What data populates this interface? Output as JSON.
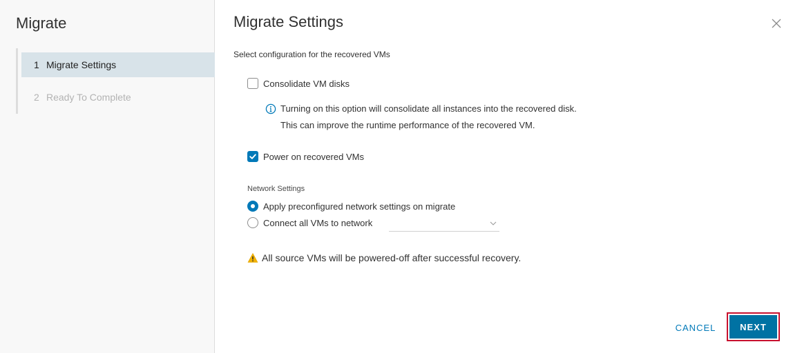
{
  "sidebar": {
    "title": "Migrate",
    "steps": [
      {
        "number": "1",
        "label": "Migrate Settings"
      },
      {
        "number": "2",
        "label": "Ready To Complete"
      }
    ]
  },
  "main": {
    "title": "Migrate Settings",
    "subtitle": "Select configuration for the recovered VMs",
    "consolidate": {
      "label": "Consolidate VM disks",
      "info_line1": "Turning on this option will consolidate all instances into the recovered disk.",
      "info_line2": "This can improve the runtime performance of the recovered VM."
    },
    "power_on": {
      "label": "Power on recovered VMs"
    },
    "network": {
      "label": "Network Settings",
      "option_apply": "Apply preconfigured network settings on migrate",
      "option_connect": "Connect all VMs to network",
      "network_select_value": ""
    },
    "warning": "All source VMs will be powered-off after successful recovery.",
    "buttons": {
      "cancel": "CANCEL",
      "next": "NEXT"
    }
  },
  "colors": {
    "accent": "#0079b8",
    "primary_button": "#0072a3",
    "highlight_outline": "#c8102e",
    "warning": "#f2b200"
  }
}
